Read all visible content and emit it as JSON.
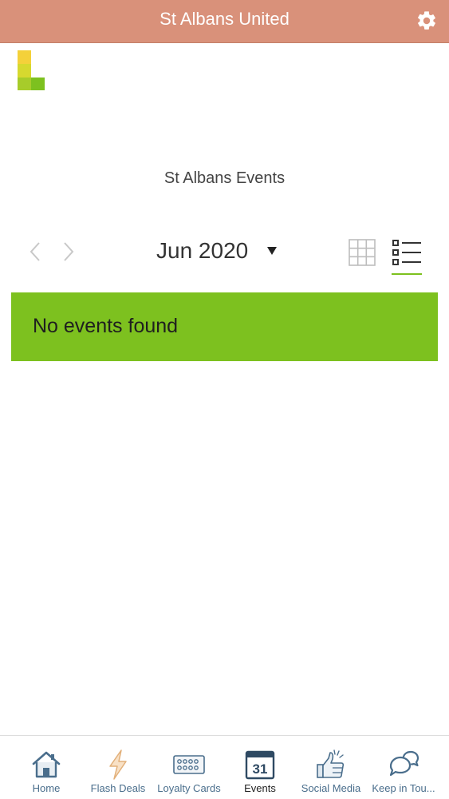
{
  "header": {
    "title": "St Albans United"
  },
  "page": {
    "title": "St Albans Events"
  },
  "calendar": {
    "month_label": "Jun 2020",
    "empty_message": "No events found"
  },
  "icons": {
    "settings": "gear-icon",
    "prev": "chevron-left-icon",
    "next": "chevron-right-icon",
    "dropdown": "caret-down-icon",
    "grid": "grid-view-icon",
    "list": "list-view-icon"
  },
  "colors": {
    "header": "#d9917a",
    "accent": "#7dc11f",
    "nav_text": "#4a6e8c"
  },
  "bottom_nav": {
    "items": [
      {
        "label": "Home",
        "icon": "home-icon"
      },
      {
        "label": "Flash Deals",
        "icon": "lightning-icon"
      },
      {
        "label": "Loyalty Cards",
        "icon": "loyalty-card-icon"
      },
      {
        "label": "Events",
        "icon": "calendar-icon",
        "calendar_day": "31",
        "active": true
      },
      {
        "label": "Social Media",
        "icon": "thumbs-up-icon"
      },
      {
        "label": "Keep in Tou...",
        "icon": "chat-bubbles-icon"
      }
    ]
  }
}
